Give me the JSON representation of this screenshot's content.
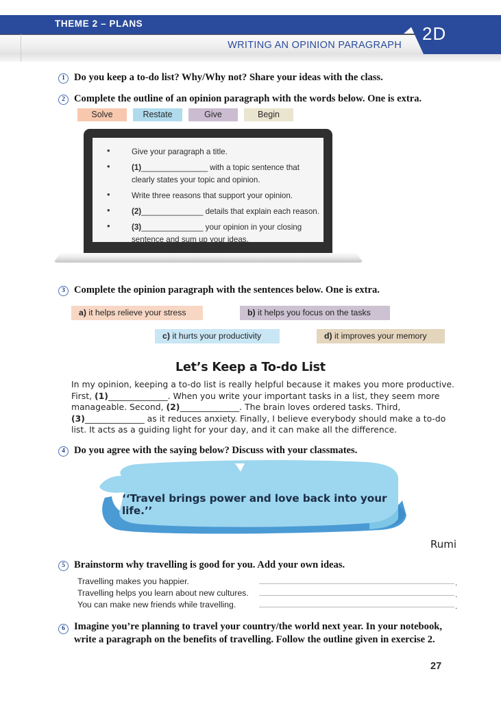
{
  "header": {
    "theme": "THEME 2 – PLANS",
    "subtitle": "WRITING AN OPINION PARAGRAPH",
    "code": "2D",
    "accent_blue": "#2a4b9b"
  },
  "exercises": [
    {
      "num": "1",
      "text": "Do you keep a to-do list? Why/Why not? Share your ideas with the class."
    },
    {
      "num": "2",
      "text": "Complete the outline of an opinion paragraph with the words below. One is extra."
    },
    {
      "num": "3",
      "text": "Complete the opinion paragraph with the sentences below. One is extra."
    },
    {
      "num": "4",
      "text": "Do you agree with the saying below? Discuss with your classmates."
    },
    {
      "num": "5",
      "text": "Brainstorm why travelling is good for you. Add your own ideas."
    },
    {
      "num": "6",
      "line1": "Imagine you’re planning to travel your country/the world next year. In your notebook,",
      "line2": "write a paragraph on the benefits of travelling. Follow the outline given in exercise 2."
    }
  ],
  "word_bank": [
    {
      "label": "Solve",
      "color": "#f7c8ae"
    },
    {
      "label": "Restate",
      "color": "#b0dbed"
    },
    {
      "label": "Give",
      "color": "#cbbcd1"
    },
    {
      "label": "Begin",
      "color": "#eae5cf"
    }
  ],
  "laptop_outline": [
    {
      "bullet": "•",
      "pre": "",
      "blank": "",
      "post": "Give your paragraph a title."
    },
    {
      "bullet": "•",
      "pre": "(1)",
      "blank": "_______________",
      "post": " with a topic sentence that clearly states your topic and opinion."
    },
    {
      "bullet": "•",
      "pre": "",
      "blank": "",
      "post": "Write three reasons that support your opinion."
    },
    {
      "bullet": "•",
      "pre": "(2)",
      "blank": "______________",
      "post": " details that explain each reason."
    },
    {
      "bullet": "•",
      "pre": "(3)",
      "blank": "______________",
      "post": " your opinion in your closing sentence and sum up your ideas."
    }
  ],
  "sentence_bank": [
    {
      "letter": "a)",
      "text": "it helps relieve your stress",
      "color": "#f7d7c4"
    },
    {
      "letter": "b)",
      "text": "it helps you focus on the tasks",
      "color": "#ccc2d2"
    },
    {
      "letter": "c)",
      "text": "it hurts your productivity",
      "color": "#c9e6f5"
    },
    {
      "letter": "d)",
      "text": "it improves your memory",
      "color": "#e4d5bd"
    }
  ],
  "paragraph": {
    "title": "Let’s Keep a To-do List",
    "s1": "In my opinion, keeping a to-do list is really helpful because it makes you more productive. First, ",
    "b1": "(1)",
    "blank1": "______________",
    "s2": ". When you write your important tasks in a list, they seem more manageable. Second, ",
    "b2": "(2)",
    "blank2": "______________",
    "s3": ". The brain loves ordered tasks. Third, ",
    "b3": "(3)",
    "blank3": "______________",
    "s4": " as it reduces anxiety. Finally, I believe everybody should make a to-do list. It acts as a guiding light for your day, and it can make all the difference."
  },
  "quote": {
    "text": "‘‘Travel brings power and love back into your life.’’",
    "author": "Rumi",
    "banner_light": "#9dd6ef",
    "banner_dark": "#4a9ad4"
  },
  "brainstorm": [
    "Travelling makes you happier.",
    "Travelling helps you learn about new cultures.",
    "You can make new friends while travelling."
  ],
  "brainstorm_dot": ".",
  "page_number": "27"
}
